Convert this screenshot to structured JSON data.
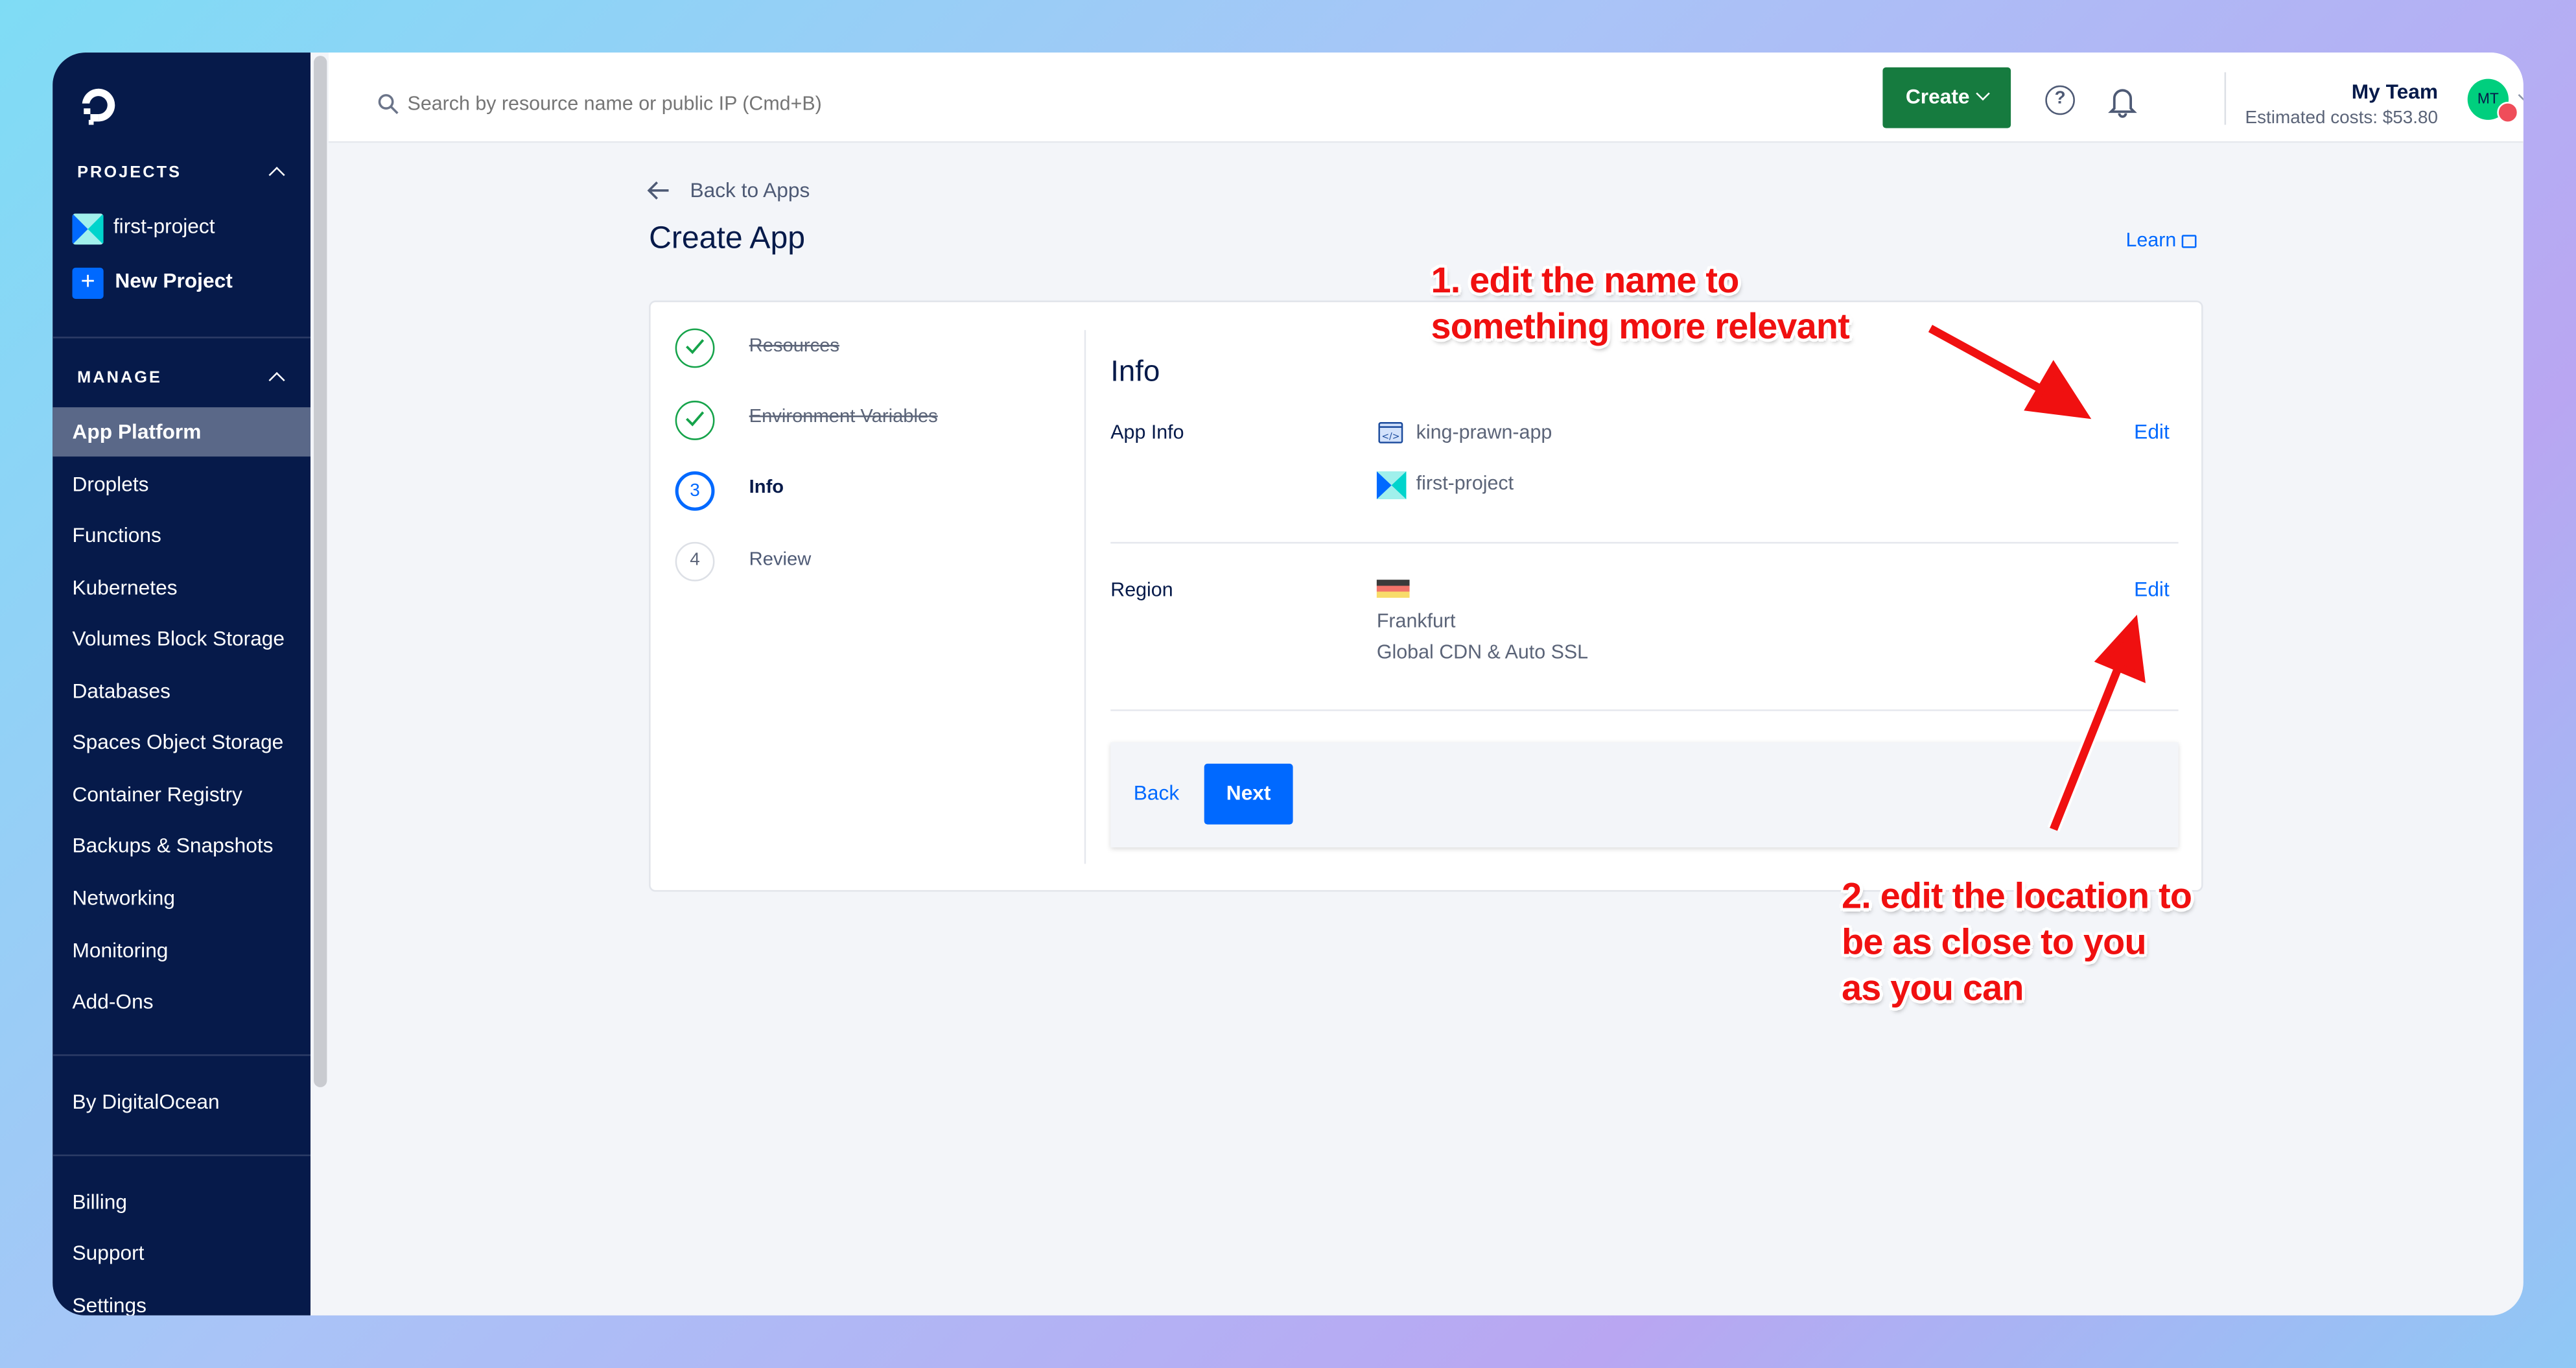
{
  "sidebar": {
    "projects_label": "PROJECTS",
    "projects": [
      {
        "label": "first-project"
      },
      {
        "label": "New Project"
      }
    ],
    "manage_label": "MANAGE",
    "items": [
      {
        "label": "App Platform",
        "active": true
      },
      {
        "label": "Droplets"
      },
      {
        "label": "Functions"
      },
      {
        "label": "Kubernetes"
      },
      {
        "label": "Volumes Block Storage"
      },
      {
        "label": "Databases"
      },
      {
        "label": "Spaces Object Storage"
      },
      {
        "label": "Container Registry"
      },
      {
        "label": "Backups & Snapshots"
      },
      {
        "label": "Networking"
      },
      {
        "label": "Monitoring"
      },
      {
        "label": "Add-Ons"
      }
    ],
    "by_label": "By DigitalOcean",
    "bottom": [
      {
        "label": "Billing"
      },
      {
        "label": "Support"
      },
      {
        "label": "Settings"
      }
    ]
  },
  "header": {
    "search_placeholder": "Search by resource name or public IP (Cmd+B)",
    "create_label": "Create",
    "team_name": "My Team",
    "estimated_costs": "Estimated costs: $53.80",
    "avatar_initials": "MT"
  },
  "page": {
    "back_label": "Back to Apps",
    "title": "Create App",
    "learn_label": "Learn",
    "steps": [
      {
        "num": "",
        "label": "Resources",
        "state": "done"
      },
      {
        "num": "",
        "label": "Environment Variables",
        "state": "done"
      },
      {
        "num": "3",
        "label": "Info",
        "state": "current"
      },
      {
        "num": "4",
        "label": "Review",
        "state": "pending"
      }
    ],
    "info": {
      "heading": "Info",
      "app_info_label": "App Info",
      "app_name": "king-prawn-app",
      "project_name": "first-project",
      "region_label": "Region",
      "region_name": "Frankfurt",
      "region_detail": "Global CDN & Auto SSL",
      "edit_label": "Edit"
    },
    "back_button": "Back",
    "next_button": "Next"
  },
  "annotations": {
    "note1": [
      "1. edit the name to",
      "something more relevant"
    ],
    "note2": [
      "2. edit the location to",
      "be as close to you",
      "as you can"
    ]
  },
  "colors": {
    "sidebar": "#061a4a",
    "primary": "#0069ff",
    "create": "#15803d",
    "success": "#15a34a",
    "annotation": "#f01010"
  }
}
